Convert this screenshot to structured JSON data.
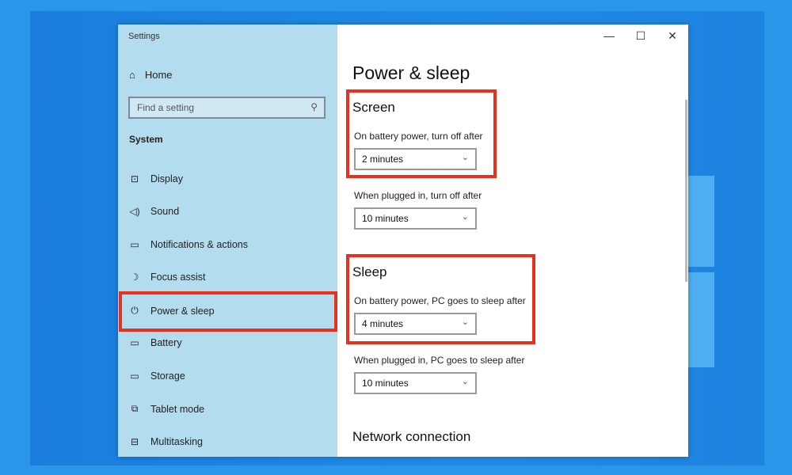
{
  "window": {
    "title": "Settings",
    "minimize": "—",
    "maximize": "☐",
    "close": "✕"
  },
  "sidebar": {
    "home": "Home",
    "search_placeholder": "Find a setting",
    "section": "System",
    "items": [
      {
        "label": "Display",
        "icon": "⊡"
      },
      {
        "label": "Sound",
        "icon": "🔈"
      },
      {
        "label": "Notifications & actions",
        "icon": "▭"
      },
      {
        "label": "Focus assist",
        "icon": "☽"
      },
      {
        "label": "Power & sleep",
        "icon": "⏻"
      },
      {
        "label": "Battery",
        "icon": "▭"
      },
      {
        "label": "Storage",
        "icon": "▭"
      },
      {
        "label": "Tablet mode",
        "icon": "⧉"
      },
      {
        "label": "Multitasking",
        "icon": "⊟"
      }
    ],
    "selected": "Power & sleep"
  },
  "main": {
    "title": "Power & sleep",
    "screen": {
      "heading": "Screen",
      "battery_label": "On battery power, turn off after",
      "battery_value": "2 minutes",
      "plugged_label": "When plugged in, turn off after",
      "plugged_value": "10 minutes"
    },
    "sleep": {
      "heading": "Sleep",
      "battery_label": "On battery power, PC goes to sleep after",
      "battery_value": "4 minutes",
      "plugged_label": "When plugged in, PC goes to sleep after",
      "plugged_value": "10 minutes"
    },
    "network_heading": "Network connection"
  },
  "colors": {
    "highlight": "#e8301d",
    "sidebar": "#b3dcef",
    "desktop": "#1f8ae6"
  }
}
